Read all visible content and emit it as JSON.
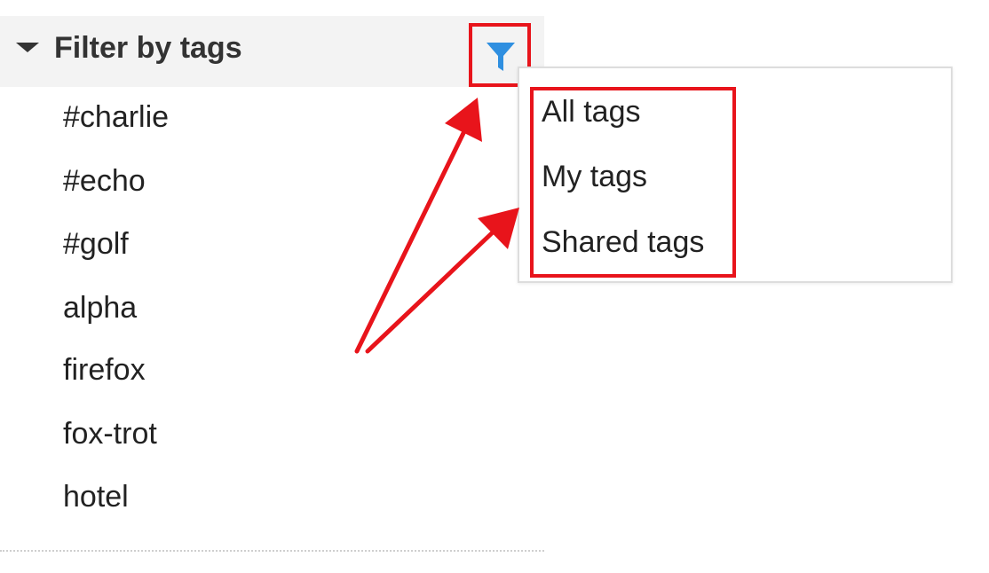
{
  "panel": {
    "title": "Filter by tags",
    "tags": [
      "#charlie",
      "#echo",
      "#golf",
      "alpha",
      "firefox",
      "fox-trot",
      "hotel"
    ]
  },
  "filter_menu": {
    "items": [
      "All tags",
      "My tags",
      "Shared tags"
    ]
  },
  "icons": {
    "collapse": "caret-down-icon",
    "filter": "funnel-icon"
  },
  "colors": {
    "annotation": "#e8141b",
    "filter_icon": "#2f8fe0",
    "header_bg": "#f3f3f3"
  }
}
